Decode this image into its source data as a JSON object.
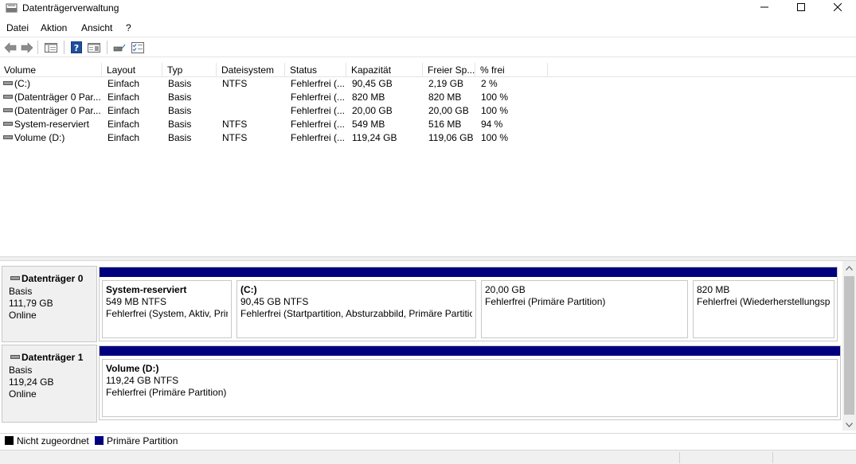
{
  "window": {
    "title": "Datenträgerverwaltung",
    "icon": "disk-management-icon",
    "controls": [
      "minimize-icon",
      "maximize-icon",
      "close-icon"
    ]
  },
  "menu": [
    "Datei",
    "Aktion",
    "Ansicht",
    "?"
  ],
  "toolbar": [
    "back-arrow-icon",
    "forward-arrow-icon",
    "console-tree-icon",
    "help-icon",
    "properties-icon",
    "disk-connect-icon",
    "checklist-icon"
  ],
  "volumes": {
    "columns": [
      "Volume",
      "Layout",
      "Typ",
      "Dateisystem",
      "Status",
      "Kapazität",
      "Freier Sp...",
      "% frei"
    ],
    "rows": [
      [
        "(C:)",
        "Einfach",
        "Basis",
        "NTFS",
        "Fehlerfrei (...",
        "90,45 GB",
        "2,19 GB",
        "2 %"
      ],
      [
        "(Datenträger 0 Par...",
        "Einfach",
        "Basis",
        "",
        "Fehlerfrei (...",
        "820 MB",
        "820 MB",
        "100 %"
      ],
      [
        "(Datenträger 0 Par...",
        "Einfach",
        "Basis",
        "",
        "Fehlerfrei (...",
        "20,00 GB",
        "20,00 GB",
        "100 %"
      ],
      [
        "System-reserviert",
        "Einfach",
        "Basis",
        "NTFS",
        "Fehlerfrei (...",
        "549 MB",
        "516 MB",
        "94 %"
      ],
      [
        "Volume (D:)",
        "Einfach",
        "Basis",
        "NTFS",
        "Fehlerfrei (...",
        "119,24 GB",
        "119,06 GB",
        "100 %"
      ]
    ]
  },
  "disks": [
    {
      "name": "Datenträger 0",
      "type": "Basis",
      "size": "111,79 GB",
      "state": "Online",
      "partitions": [
        {
          "name": "System-reserviert",
          "size": "549 MB NTFS",
          "status": "Fehlerfrei (System, Aktiv, Primäre Partition)"
        },
        {
          "name": "(C:)",
          "size": "90,45 GB NTFS",
          "status": "Fehlerfrei (Startpartition, Absturzabbild, Primäre Partition)"
        },
        {
          "name": "",
          "size": "20,00 GB",
          "status": "Fehlerfrei (Primäre Partition)"
        },
        {
          "name": "",
          "size": "820 MB",
          "status": "Fehlerfrei (Wiederherstellungspartition)"
        }
      ]
    },
    {
      "name": "Datenträger 1",
      "type": "Basis",
      "size": "119,24 GB",
      "state": "Online",
      "partitions": [
        {
          "name": "Volume  (D:)",
          "size": "119,24 GB NTFS",
          "status": "Fehlerfrei (Primäre Partition)"
        }
      ]
    }
  ],
  "legend": [
    {
      "label": "Nicht zugeordnet",
      "color": "#000000"
    },
    {
      "label": "Primäre Partition",
      "color": "#00007e"
    }
  ],
  "colors": {
    "primary_partition": "#00007e",
    "unallocated": "#000000"
  }
}
